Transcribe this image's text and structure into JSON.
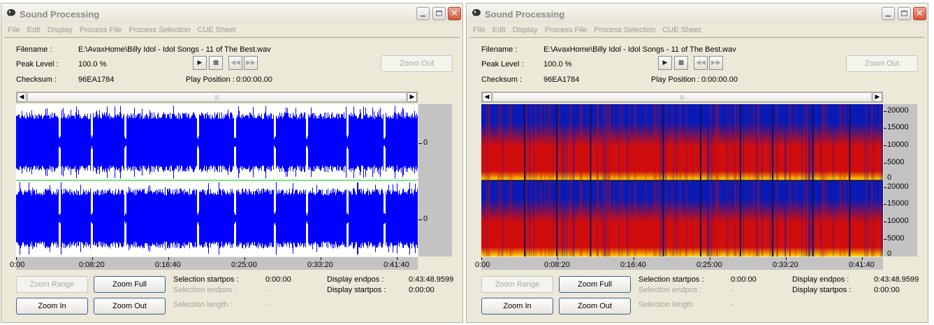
{
  "title": "Sound Processing",
  "menu": [
    "File",
    "Edit",
    "Display",
    "Process File",
    "Process Selection",
    "CUE Sheet"
  ],
  "info": {
    "filename_label": "Filename :",
    "filename_value": "E:\\AvaxHome\\Billy Idol - Idol Songs - 11 of The Best.wav",
    "peak_label": "Peak Level :",
    "peak_value": "100.0 %",
    "checksum_label": "Checksum :",
    "checksum_value": "96EA1784",
    "play_position_label": "Play Position :",
    "play_position_value": "0:00:00.00"
  },
  "transport": {
    "play_icon": "play-icon",
    "stop_icon": "stop-icon",
    "rewind_icon": "rewind-icon",
    "forward_icon": "fast-forward-icon"
  },
  "buttons": {
    "zoom_out_top": "Zoom Out",
    "zoom_range": "Zoom Range",
    "zoom_full": "Zoom Full",
    "zoom_in": "Zoom In",
    "zoom_out": "Zoom Out"
  },
  "selection": {
    "startpos_label": "Selection startpos :",
    "startpos_value": "0:00:00",
    "endpos_label": "Selection endpos :",
    "endpos_value": "-",
    "length_label": "Selection length :",
    "length_value": "-"
  },
  "display_pos": {
    "endpos_label": "Display endpos :",
    "endpos_value": "0:43:48.9599",
    "startpos_label": "Display startpos :",
    "startpos_value": "0:00:00"
  },
  "scrollbar_grip": "|||",
  "timeline": [
    "0:00",
    "0:08:20",
    "0:16:40",
    "0:25:00",
    "0:33:20",
    "0:41:40"
  ],
  "waveform": {
    "channel_zero_label": "0",
    "color": "#0000ff",
    "center_line_color": "#00cc00",
    "segment_starts_fraction": [
      0,
      0.108,
      0.188,
      0.272,
      0.453,
      0.546,
      0.645,
      0.725,
      0.825,
      0.917
    ]
  },
  "spectrogram": {
    "freq_labels": [
      "20000",
      "15000",
      "10000",
      "5000",
      "0"
    ],
    "colors": {
      "low": "#0a1ab4",
      "mid": "#d10d0d",
      "high": "#ffe100"
    }
  }
}
